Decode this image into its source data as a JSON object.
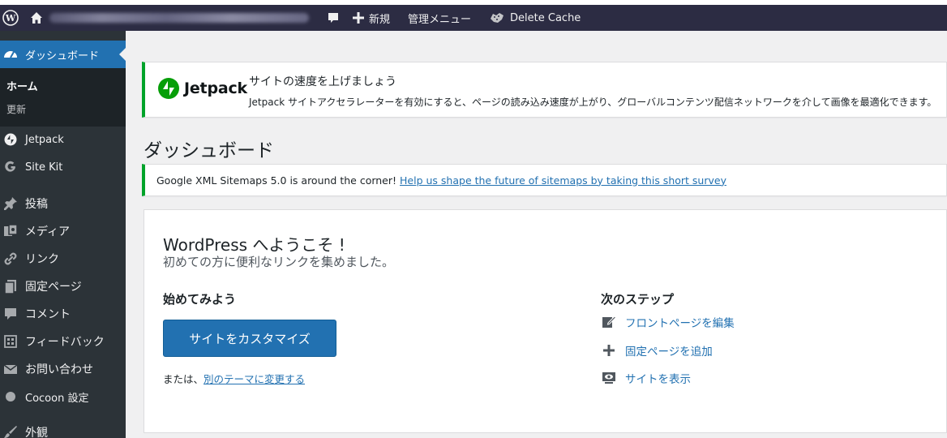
{
  "admin_bar": {
    "new_label": "新規",
    "admin_menu_label": "管理メニュー",
    "delete_cache_label": "Delete Cache"
  },
  "sidebar": {
    "active": {
      "label": "ダッシュボード"
    },
    "submenu": [
      {
        "label": "ホーム"
      },
      {
        "label": "更新"
      }
    ],
    "items": [
      {
        "label": "Jetpack",
        "icon": "jetpack-icon"
      },
      {
        "label": "Site Kit",
        "icon": "site-kit-icon"
      },
      {
        "label": "投稿",
        "icon": "pin-icon"
      },
      {
        "label": "メディア",
        "icon": "media-icon"
      },
      {
        "label": "リンク",
        "icon": "link-icon"
      },
      {
        "label": "固定ページ",
        "icon": "page-icon"
      },
      {
        "label": "コメント",
        "icon": "comment-icon"
      },
      {
        "label": "フィードバック",
        "icon": "feedback-icon"
      },
      {
        "label": "お問い合わせ",
        "icon": "mail-icon"
      },
      {
        "label": "Cocoon 設定",
        "icon": "circle-icon"
      },
      {
        "label": "外観",
        "icon": "brush-icon"
      }
    ]
  },
  "jetpack_notice": {
    "brand": "Jetpack",
    "title": "サイトの速度を上げましょう",
    "description": "Jetpack サイトアクセラレーターを有効にすると、ページの読み込み速度が上がり、グローバルコンテンツ配信ネットワークを介して画像を最適化できます。"
  },
  "page_title": "ダッシュボード",
  "sitemap_notice": {
    "text": "Google XML Sitemaps 5.0 is around the corner!",
    "link": "Help us shape the future of sitemaps by taking this short survey"
  },
  "welcome": {
    "title": "WordPress へようこそ !",
    "subtitle": "初めての方に便利なリンクを集めました。",
    "get_started": "始めてみよう",
    "customize_button": "サイトをカスタマイズ",
    "or_text": "または、",
    "change_theme_link": "別のテーマに変更する",
    "next_steps": "次のステップ",
    "steps": [
      {
        "label": "フロントページを編集",
        "icon": "edit-icon"
      },
      {
        "label": "固定ページを追加",
        "icon": "plus-icon"
      },
      {
        "label": "サイトを表示",
        "icon": "view-site-icon"
      }
    ]
  },
  "colors": {
    "admin_bar": "#2c2c43",
    "sidebar": "#2c3338",
    "accent": "#2271b1",
    "notice_green": "#00a32a"
  }
}
